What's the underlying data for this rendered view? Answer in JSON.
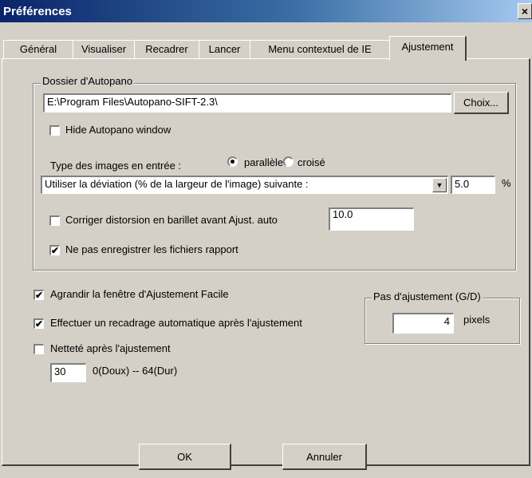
{
  "window": {
    "title": "Préférences",
    "close_glyph": "×"
  },
  "tabs": [
    {
      "label": "Général"
    },
    {
      "label": "Visualiser"
    },
    {
      "label": "Recadrer"
    },
    {
      "label": "Lancer"
    },
    {
      "label": "Menu contextuel de IE"
    },
    {
      "label": "Ajustement",
      "active": true
    }
  ],
  "autopano": {
    "group_label": "Dossier d'Autopano",
    "path_value": "E:\\Program Files\\Autopano-SIFT-2.3\\",
    "browse_label": "Choix...",
    "hide_label": "Hide Autopano window",
    "hide_checked": false,
    "image_type_label": "Type des images en entrée :",
    "radio_parallel_label": "parallèle",
    "radio_crossed_label": "croisé",
    "radio_selected": "parallèle",
    "deviation_select_value": "Utiliser la déviation (% de la largeur de l'image) suivante :",
    "deviation_value": "5.0",
    "percent_label": "%",
    "barrel_label": "Corriger distorsion en barillet avant Ajust. auto",
    "barrel_checked": false,
    "barrel_value": "10.0",
    "no_report_label": "Ne pas enregistrer les fichiers rapport",
    "no_report_checked": true
  },
  "options": {
    "enlarge_label": "Agrandir la fenêtre d'Ajustement Facile",
    "enlarge_checked": true,
    "autocrop_label": "Effectuer un recadrage automatique après l'ajustement",
    "autocrop_checked": true,
    "sharpen_label": "Netteté après l'ajustement",
    "sharpen_checked": false,
    "sharpen_value": "30",
    "sharpen_range": "0(Doux) -- 64(Dur)"
  },
  "step": {
    "group_label": "Pas d'ajustement (G/D)",
    "value": "4",
    "unit": "pixels"
  },
  "footer": {
    "ok_label": "OK",
    "cancel_label": "Annuler"
  },
  "check_glyph": "✔"
}
